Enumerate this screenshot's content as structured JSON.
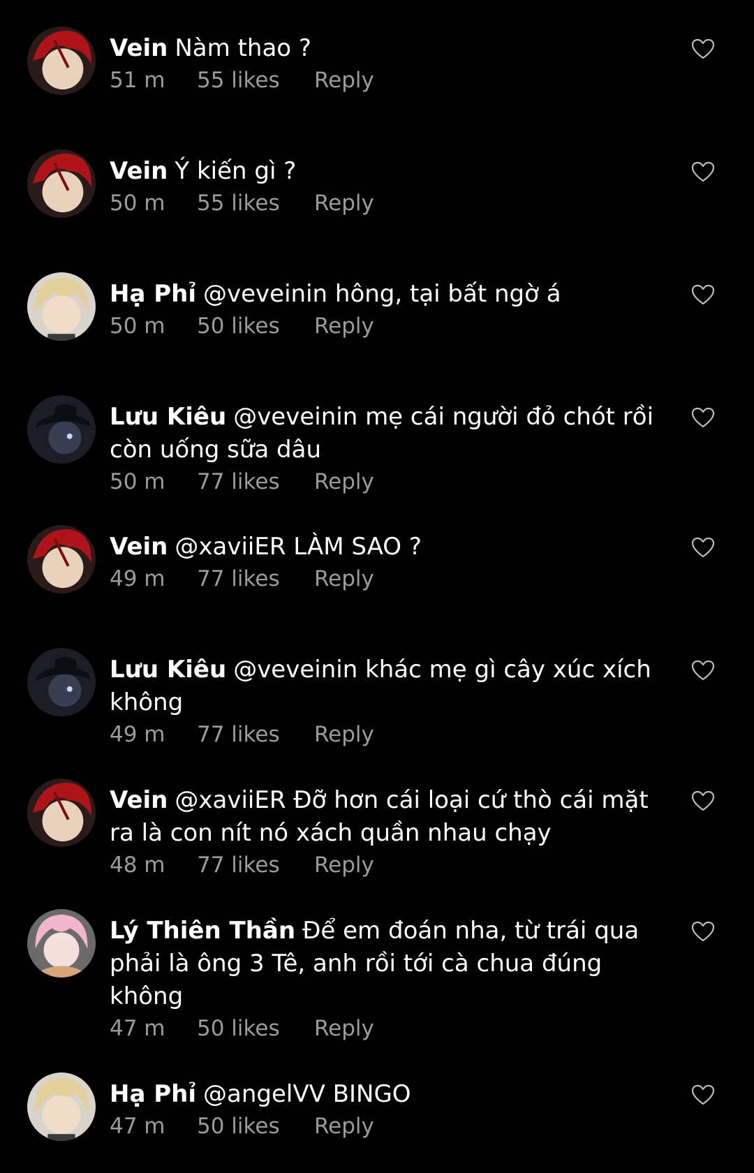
{
  "comments": [
    {
      "author": "Vein",
      "text": "Nàm thao ?",
      "time": "51 m",
      "likes": "55 likes",
      "reply": "Reply",
      "avatar": "avatar-red-hair",
      "like_icon": "heart-outline-icon"
    },
    {
      "author": "Vein",
      "text": "Ý kiến gì ?",
      "time": "50 m",
      "likes": "55 likes",
      "reply": "Reply",
      "avatar": "avatar-red-hair",
      "like_icon": "heart-outline-icon"
    },
    {
      "author": "Hạ Phỉ",
      "text": "@veveinin hông, tại bất ngờ á",
      "time": "50 m",
      "likes": "50 likes",
      "reply": "Reply",
      "avatar": "avatar-blonde-hair",
      "like_icon": "heart-outline-icon"
    },
    {
      "author": "Lưu Kiêu",
      "text": "@veveinin mẹ cái người đỏ chót rồi còn uống sữa dâu",
      "time": "50 m",
      "likes": "77 likes",
      "reply": "Reply",
      "avatar": "avatar-dark-hat",
      "like_icon": "heart-outline-icon"
    },
    {
      "author": "Vein",
      "text": "@xaviiER LÀM SAO ?",
      "time": "49 m",
      "likes": "77 likes",
      "reply": "Reply",
      "avatar": "avatar-red-hair",
      "like_icon": "heart-outline-icon"
    },
    {
      "author": "Lưu Kiêu",
      "text": "@veveinin khác mẹ gì cây xúc xích không",
      "time": "49 m",
      "likes": "77 likes",
      "reply": "Reply",
      "avatar": "avatar-dark-hat",
      "like_icon": "heart-outline-icon"
    },
    {
      "author": "Vein",
      "text": "@xaviiER Đỡ hơn cái loại cứ thò cái mặt ra là con nít nó xách quần nhau chạy",
      "time": "48 m",
      "likes": "77 likes",
      "reply": "Reply",
      "avatar": "avatar-red-hair",
      "like_icon": "heart-outline-icon"
    },
    {
      "author": "Lý Thiên Thần",
      "text": "Để em đoán nha, từ trái qua phải là ông 3 Tê, anh rồi tới cà chua đúng không",
      "time": "47 m",
      "likes": "50 likes",
      "reply": "Reply",
      "avatar": "avatar-pink-hair",
      "like_icon": "heart-outline-icon"
    },
    {
      "author": "Hạ Phỉ",
      "text": "@angelVV BINGO",
      "time": "47 m",
      "likes": "50 likes",
      "reply": "Reply",
      "avatar": "avatar-blonde-hair",
      "like_icon": "heart-outline-icon"
    }
  ]
}
